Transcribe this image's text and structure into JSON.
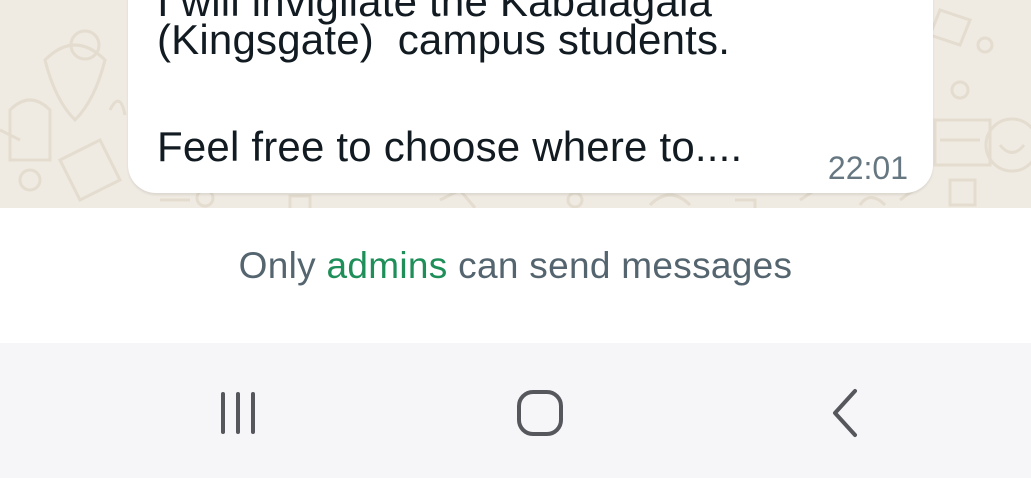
{
  "message": {
    "lines": [
      "I will invigilate the Kabalagala",
      "(Kingsgate)  campus students.",
      "Feel free to choose where to...."
    ],
    "time": "22:01"
  },
  "notice": {
    "prefix": "Only ",
    "link": "admins",
    "suffix": " can send messages"
  },
  "navbar": {
    "icons": [
      "recents-icon",
      "home-icon",
      "back-icon"
    ]
  },
  "colors": {
    "wallpaper": "#efeae2",
    "accent": "#1f8f5a",
    "nav_background": "#f6f6f8"
  }
}
